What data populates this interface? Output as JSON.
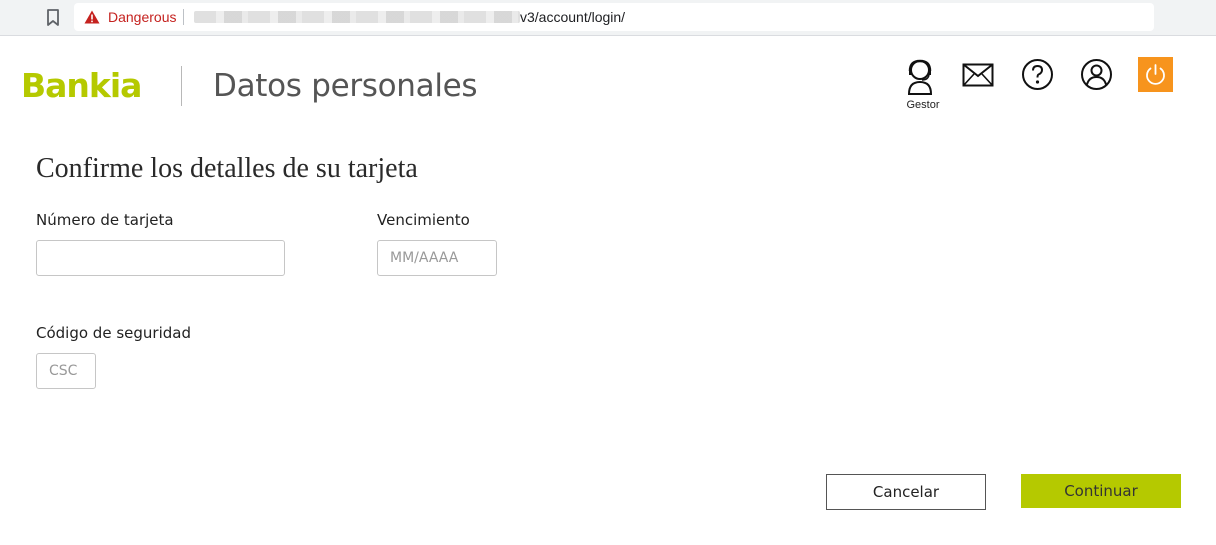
{
  "browser": {
    "security_label": "Dangerous",
    "url_visible": "v3/account/login/"
  },
  "header": {
    "brand": "Bankia",
    "title": "Datos personales",
    "gestor_label": "Gestor",
    "icons": [
      "bookmark-icon",
      "warning-icon",
      "gestor-icon",
      "mail-icon",
      "help-icon",
      "user-icon",
      "power-icon"
    ]
  },
  "form": {
    "heading": "Confirme los detalles de su tarjeta",
    "card_number": {
      "label": "Número de tarjeta",
      "value": "",
      "placeholder": ""
    },
    "expiry": {
      "label": "Vencimiento",
      "value": "",
      "placeholder": "MM/AAAA"
    },
    "security_code": {
      "label": "Código de seguridad",
      "value": "",
      "placeholder": "CSC"
    }
  },
  "actions": {
    "cancel_label": "Cancelar",
    "continue_label": "Continuar"
  },
  "colors": {
    "brand_green": "#b5c900",
    "power_orange": "#f7941d",
    "danger_red": "#c5221f"
  }
}
